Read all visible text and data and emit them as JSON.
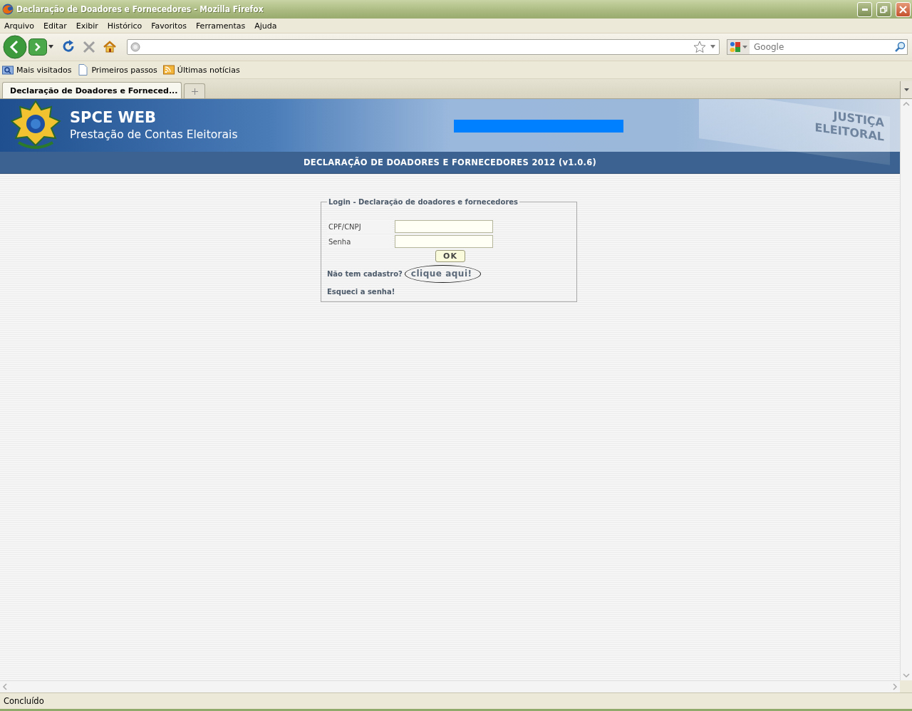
{
  "window": {
    "title": "Declaração de Doadores e Fornecedores - Mozilla Firefox"
  },
  "menu": [
    "Arquivo",
    "Editar",
    "Exibir",
    "Histórico",
    "Favoritos",
    "Ferramentas",
    "Ajuda"
  ],
  "toolbar": {
    "search": {
      "placeholder": "Google"
    }
  },
  "bookmarks": [
    {
      "label": "Mais visitados",
      "kind": "folder"
    },
    {
      "label": "Primeiros passos",
      "kind": "page"
    },
    {
      "label": "Últimas notícias",
      "kind": "feed"
    }
  ],
  "tabs": [
    {
      "label": "Declaração de Doadores e Forneced...",
      "selected": true
    }
  ],
  "banner": {
    "title": "SPCE WEB",
    "subtitle": "Prestação de Contas Eleitorais",
    "emblem_text": [
      "JUSTIÇA",
      "ELEITORAL"
    ]
  },
  "header": "DECLARAÇÃO DE DOADORES E FORNECEDORES 2012 (v1.0.6)",
  "login": {
    "legend": "Login - Declaração de doadores e fornecedores",
    "fields": [
      {
        "label": "CPF/CNPJ"
      },
      {
        "label": "Senha"
      }
    ],
    "submit": "OK",
    "signup_prompt": "Não tem cadastro?",
    "signup_link": "clique aqui!",
    "forgot_link": "Esqueci a senha!"
  },
  "status_bar": "Concluído"
}
